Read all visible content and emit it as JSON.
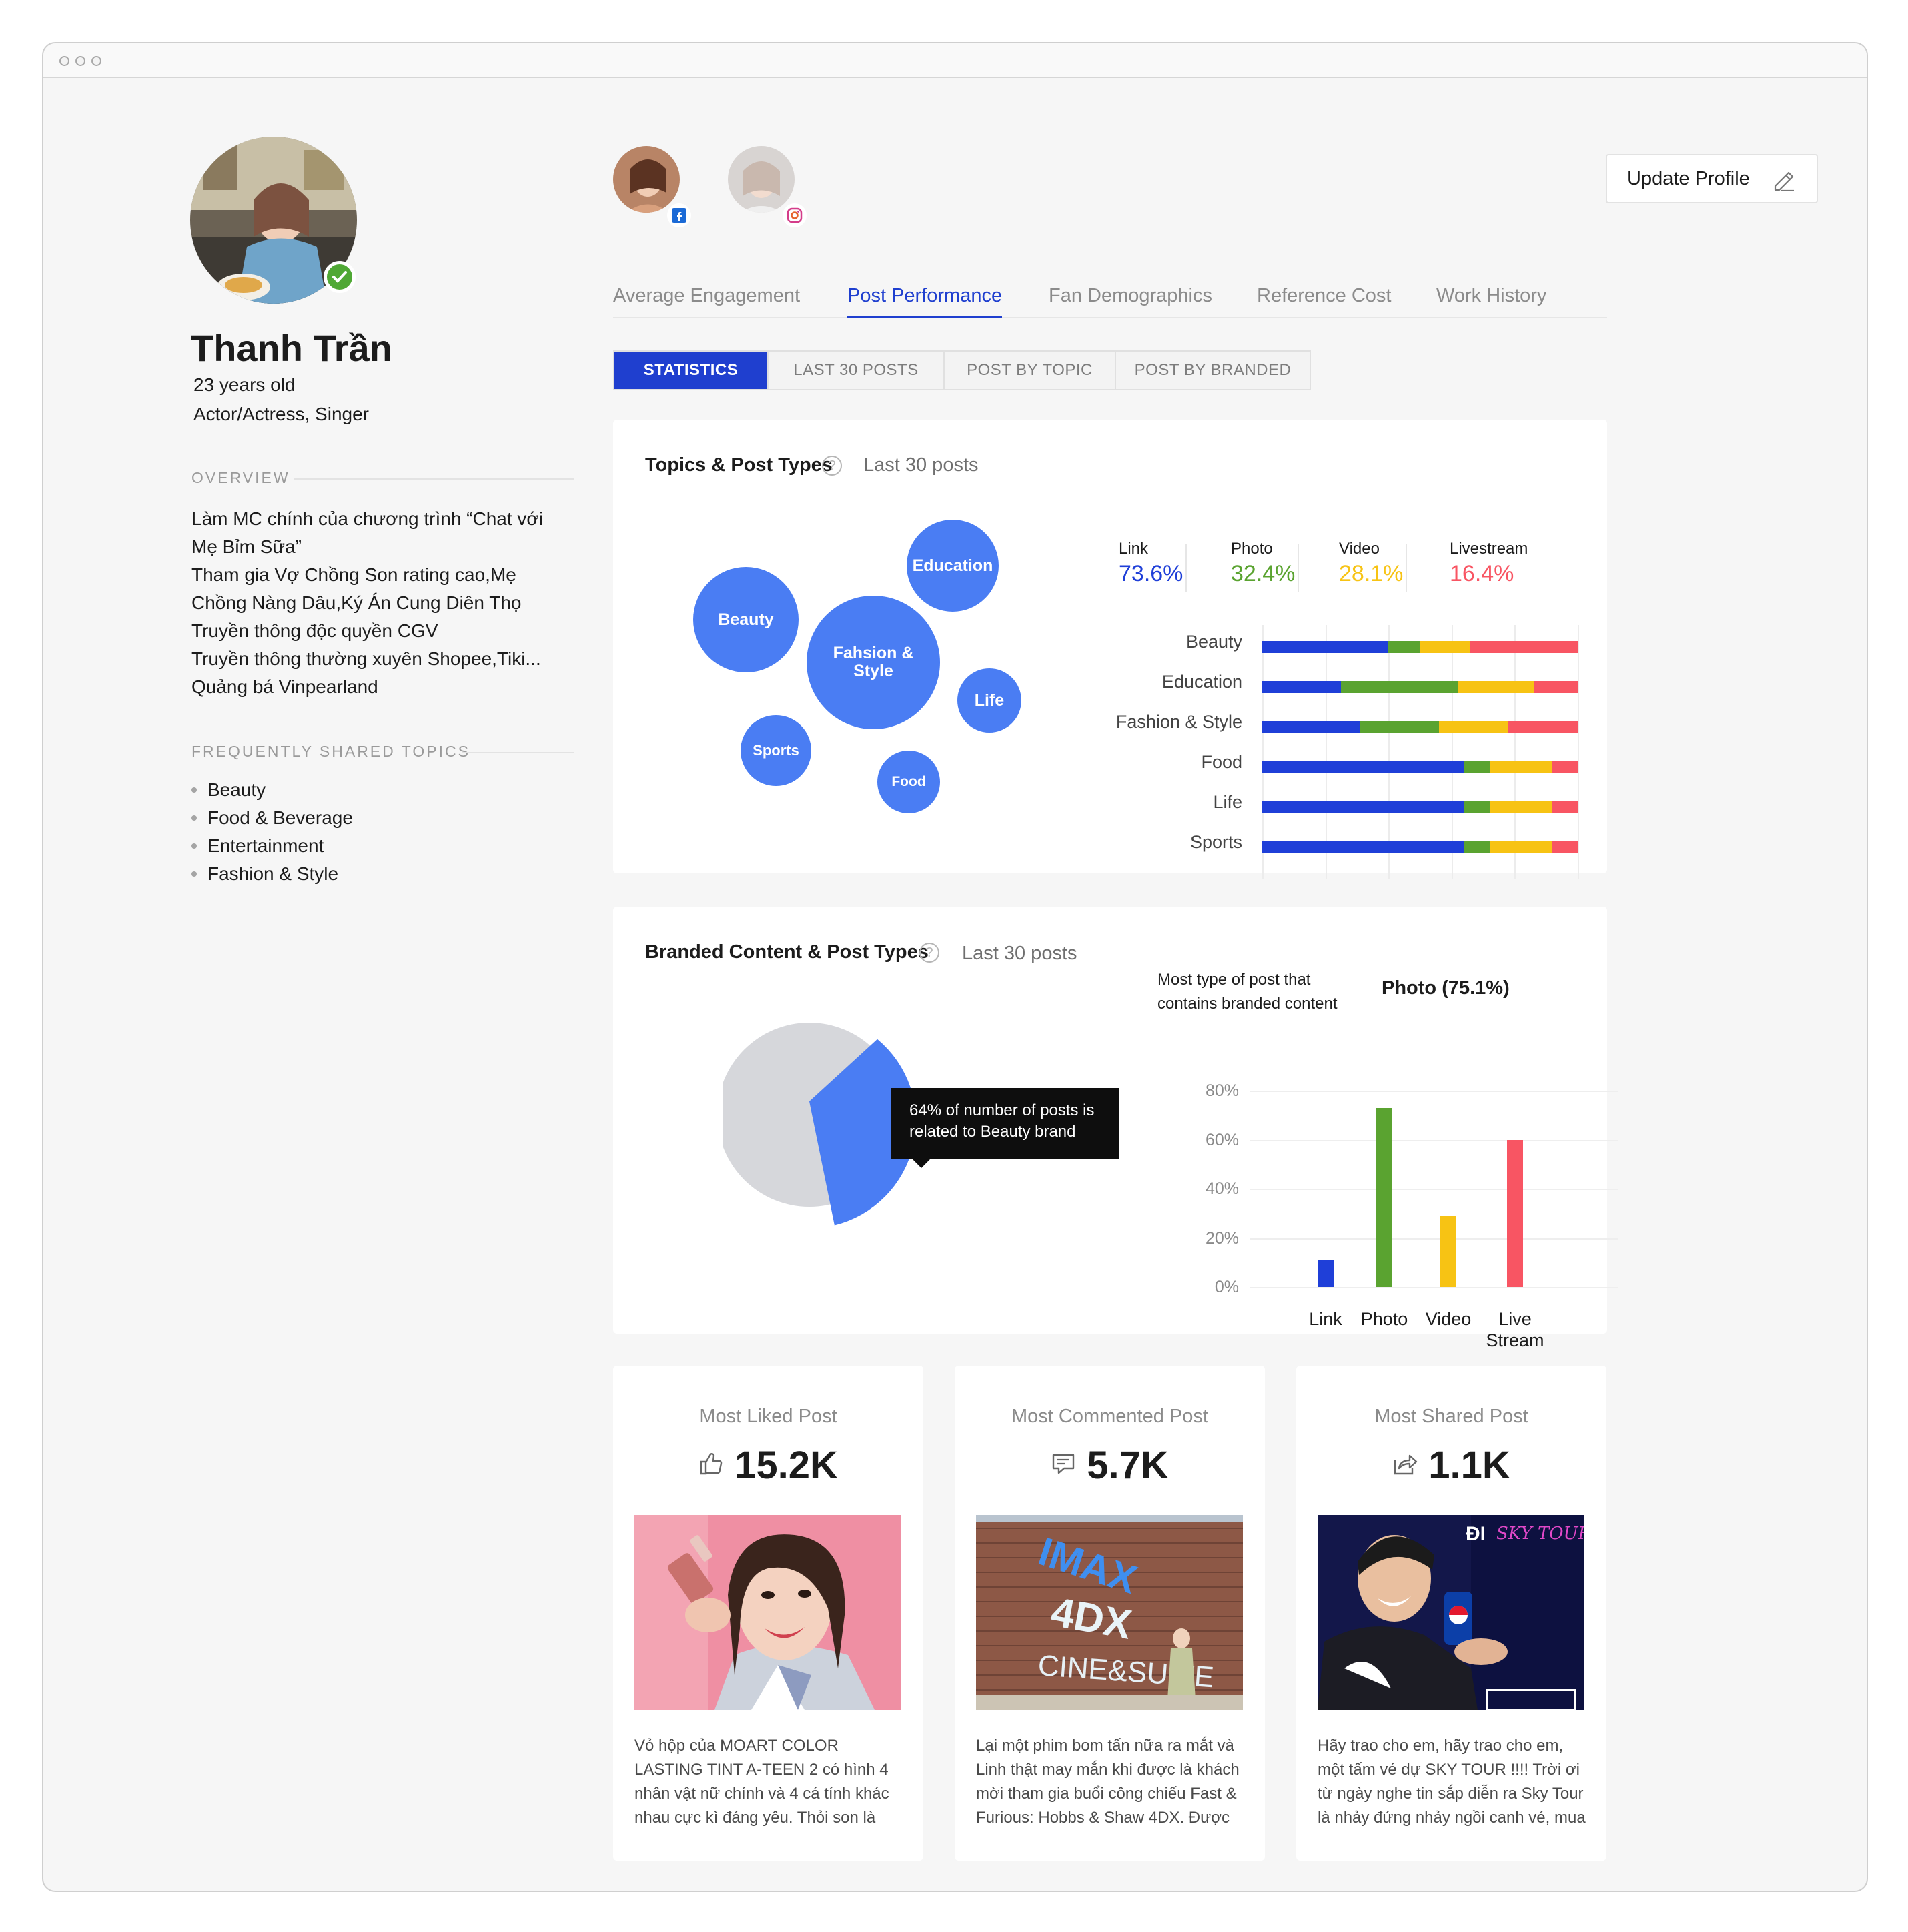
{
  "window": {
    "controls": [
      "close",
      "minimize",
      "maximize"
    ]
  },
  "profile": {
    "name": "Thanh Trần",
    "age": "23 years old",
    "role": "Actor/Actress, Singer",
    "verified": true,
    "overview_heading": "OVERVIEW",
    "overview_lines": [
      "Làm MC chính của chương trình “Chat với",
      "Mẹ Bỉm Sữa”",
      "Tham gia Vợ Chồng Son rating cao,Mẹ",
      "Chồng Nàng Dâu,Ký Án Cung Diên Thọ",
      "Truyền thông độc quyền CGV",
      "Truyền thông thường xuyên Shopee,Tiki...",
      "Quảng bá Vinpearland"
    ],
    "topics_heading": "FREQUENTLY SHARED TOPICS",
    "topics": [
      "Beauty",
      "Food & Beverage",
      "Entertainment",
      "Fashion & Style"
    ]
  },
  "social_accounts": [
    {
      "network": "facebook",
      "icon": "facebook-icon"
    },
    {
      "network": "instagram",
      "icon": "instagram-icon"
    }
  ],
  "update_button": {
    "label": "Update Profile",
    "icon": "pencil-icon"
  },
  "tabs": [
    {
      "label": "Average Engagement",
      "active": false
    },
    {
      "label": "Post Performance",
      "active": true
    },
    {
      "label": "Fan Demographics",
      "active": false
    },
    {
      "label": "Reference Cost",
      "active": false
    },
    {
      "label": "Work History",
      "active": false
    }
  ],
  "subtabs": [
    {
      "label": "STATISTICS",
      "active": true
    },
    {
      "label": "LAST 30 POSTS",
      "active": false
    },
    {
      "label": "POST BY TOPIC",
      "active": false
    },
    {
      "label": "POST BY BRANDED",
      "active": false
    }
  ],
  "colors": {
    "primary": "#1f3fcf",
    "bubble": "#4a7df3",
    "link": "#1f3fd8",
    "photo": "#5aa330",
    "video": "#f7c314",
    "livestream": "#f85563",
    "pie_grey": "#d6d7db"
  },
  "topics_card": {
    "title": "Topics & Post Types",
    "subtitle": "Last 30 posts",
    "help_icon": "question-icon",
    "bubbles": [
      "Education",
      "Beauty",
      "Fahsion & Style",
      "Life",
      "Sports",
      "Food"
    ],
    "legend": [
      {
        "label": "Link",
        "value": "73.6%"
      },
      {
        "label": "Photo",
        "value": "32.4%"
      },
      {
        "label": "Video",
        "value": "28.1%"
      },
      {
        "label": "Livestream",
        "value": "16.4%"
      }
    ]
  },
  "branded_card": {
    "title": "Branded Content & Post Types",
    "subtitle": "Last 30 posts",
    "help_icon": "question-icon",
    "tooltip": "64% of number of posts is related to Beauty brand",
    "most_label": "Most type of post that contains branded content",
    "most_value": "Photo (75.1%)"
  },
  "chart_data": [
    {
      "type": "bar",
      "orientation": "horizontal",
      "stacked": true,
      "categories": [
        "Beauty",
        "Education",
        "Fashion & Style",
        "Food",
        "Life",
        "Sports"
      ],
      "series": [
        {
          "name": "Link",
          "values": [
            40,
            25,
            31,
            64,
            64,
            64
          ]
        },
        {
          "name": "Photo",
          "values": [
            10,
            37,
            25,
            8,
            8,
            8
          ]
        },
        {
          "name": "Video",
          "values": [
            16,
            24,
            22,
            20,
            20,
            20
          ]
        },
        {
          "name": "Livestream",
          "values": [
            34,
            14,
            22,
            8,
            8,
            8
          ]
        }
      ],
      "xlim": [
        0,
        100
      ],
      "grid": true
    },
    {
      "type": "pie",
      "slices": [
        {
          "name": "Beauty",
          "value": 64
        },
        {
          "name": "Other",
          "value": 36
        }
      ]
    },
    {
      "type": "bar",
      "categories": [
        "Link",
        "Photo",
        "Video",
        "Live Stream"
      ],
      "values": [
        11,
        73,
        29,
        60
      ],
      "ylim": [
        0,
        80
      ],
      "yticks": [
        "0%",
        "20%",
        "40%",
        "60%",
        "80%"
      ],
      "grid": true
    }
  ],
  "post_cards": [
    {
      "title": "Most Liked Post",
      "icon": "thumbs-up-icon",
      "value": "15.2K",
      "image": "beauty-selfie-photo",
      "text": "Vỏ hộp của MOART COLOR LASTING TINT A-TEEN 2 có hình 4 nhân vật nữ chính và 4 cá tính khác nhau cực kì đáng yêu. Thỏi son là"
    },
    {
      "title": "Most Commented Post",
      "icon": "comment-icon",
      "value": "5.7K",
      "image": "cinema-wall-photo",
      "image_texts": [
        "IMAX",
        "4DX",
        "CINE&SUITE"
      ],
      "text": "Lại một phim bom tấn nữa ra mắt và Linh thật may mắn khi được là khách mời tham gia buổi công chiếu Fast & Furious: Hobbs & Shaw 4DX. Được"
    },
    {
      "title": "Most Shared Post",
      "icon": "share-icon",
      "value": "1.1K",
      "image": "pepsi-sky-tour-photo",
      "image_texts": [
        "ĐI",
        "SKY TOUR"
      ],
      "text": "Hãy trao cho em, hãy trao cho em, một tấm vé dự SKY TOUR !!!! Trời ơi từ ngày nghe tin sắp diễn ra Sky Tour là nhảy đứng nhảy ngồi canh vé, mua"
    }
  ]
}
